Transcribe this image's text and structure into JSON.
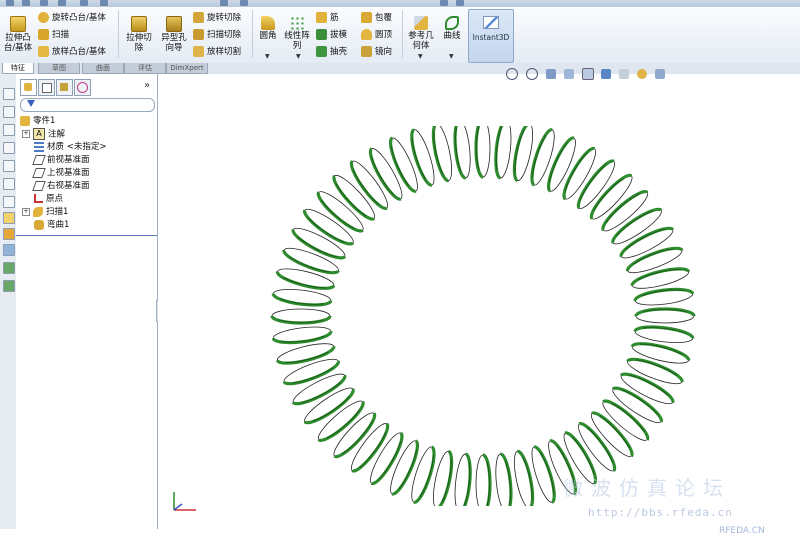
{
  "ribbon": {
    "extrude_boss": "拉伸凸台/基体",
    "revolve_boss": "旋转凸台/基体",
    "sweep": "扫描",
    "loft_boss": "放样凸台/基体",
    "extrude_cut": "拉伸切除",
    "hole_wizard": "异型孔向导",
    "revolve_cut": "旋转切除",
    "sweep_cut": "扫描切除",
    "loft_cut": "放样切割",
    "fillet": "圆角",
    "linear_pattern": "线性阵列",
    "rib": "筋",
    "draft": "拔模",
    "shell": "抽壳",
    "wrap": "包覆",
    "dome": "圆顶",
    "mirror": "镜向",
    "ref_geometry": "参考几何体",
    "curves": "曲线",
    "instant3d": "Instant3D"
  },
  "tabs": [
    "特征",
    "草图",
    "曲面",
    "评估",
    "DimXpert"
  ],
  "panel": {
    "more": "»",
    "tree": [
      {
        "label": "零件1",
        "indent": 0,
        "expandable": false
      },
      {
        "label": "注解",
        "indent": 1,
        "expandable": true
      },
      {
        "label": "材质 <未指定>",
        "indent": 1,
        "expandable": false
      },
      {
        "label": "前视基准面",
        "indent": 1,
        "expandable": false
      },
      {
        "label": "上视基准面",
        "indent": 1,
        "expandable": false
      },
      {
        "label": "右视基准面",
        "indent": 1,
        "expandable": false
      },
      {
        "label": "原点",
        "indent": 1,
        "expandable": false
      },
      {
        "label": "扫描1",
        "indent": 1,
        "expandable": true
      },
      {
        "label": "弯曲1",
        "indent": 1,
        "expandable": false
      }
    ]
  },
  "viewport": {
    "watermark_brand": "RFEDA.CN",
    "watermark_cn": "微波仿真论坛",
    "watermark_url": "http://bbs.rfeda.cn"
  },
  "colors": {
    "coil_green": "#2e8b2e",
    "coil_dark": "#1a5a1a",
    "ribbon_bg": "#eef3f9",
    "accent_blue": "#5a7cc5"
  }
}
